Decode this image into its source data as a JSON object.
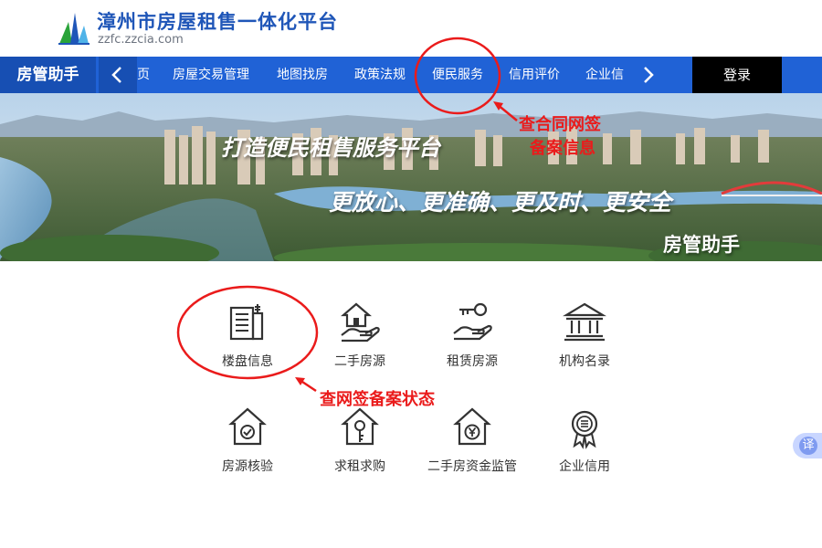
{
  "header": {
    "site_title": "漳州市房屋租售一体化平台",
    "site_domain": "zzfc.zzcia.com"
  },
  "nav": {
    "brand": "房管助手",
    "items": [
      {
        "label": "页"
      },
      {
        "label": "房屋交易管理"
      },
      {
        "label": "地图找房"
      },
      {
        "label": "政策法规"
      },
      {
        "label": "便民服务"
      },
      {
        "label": "信用评价"
      },
      {
        "label": "企业信"
      }
    ],
    "login": "登录"
  },
  "banner": {
    "slogan_1": "打造便民租售服务平台",
    "slogan_2": "更放心、更准确、更及时、更安全",
    "badge": "房管助手"
  },
  "annotations": {
    "contract_filing": [
      "查合同网签",
      "备案信息"
    ],
    "online_signing_status": "查网签备案状态"
  },
  "services": [
    {
      "label": "楼盘信息",
      "icon": "building-list-icon"
    },
    {
      "label": "二手房源",
      "icon": "hand-house-icon"
    },
    {
      "label": "租赁房源",
      "icon": "hand-key-icon"
    },
    {
      "label": "机构名录",
      "icon": "institution-icon"
    },
    {
      "label": "房源核验",
      "icon": "house-check-icon"
    },
    {
      "label": "求租求购",
      "icon": "house-key-icon"
    },
    {
      "label": "二手房资金监管",
      "icon": "house-yen-icon"
    },
    {
      "label": "企业信用",
      "icon": "credit-badge-icon"
    }
  ],
  "translate_button": "译",
  "colors": {
    "brand_blue": "#2062d6",
    "brand_dark_blue": "#174fb3",
    "annotation_red": "#ea1b1b",
    "login_bg": "#000000"
  }
}
